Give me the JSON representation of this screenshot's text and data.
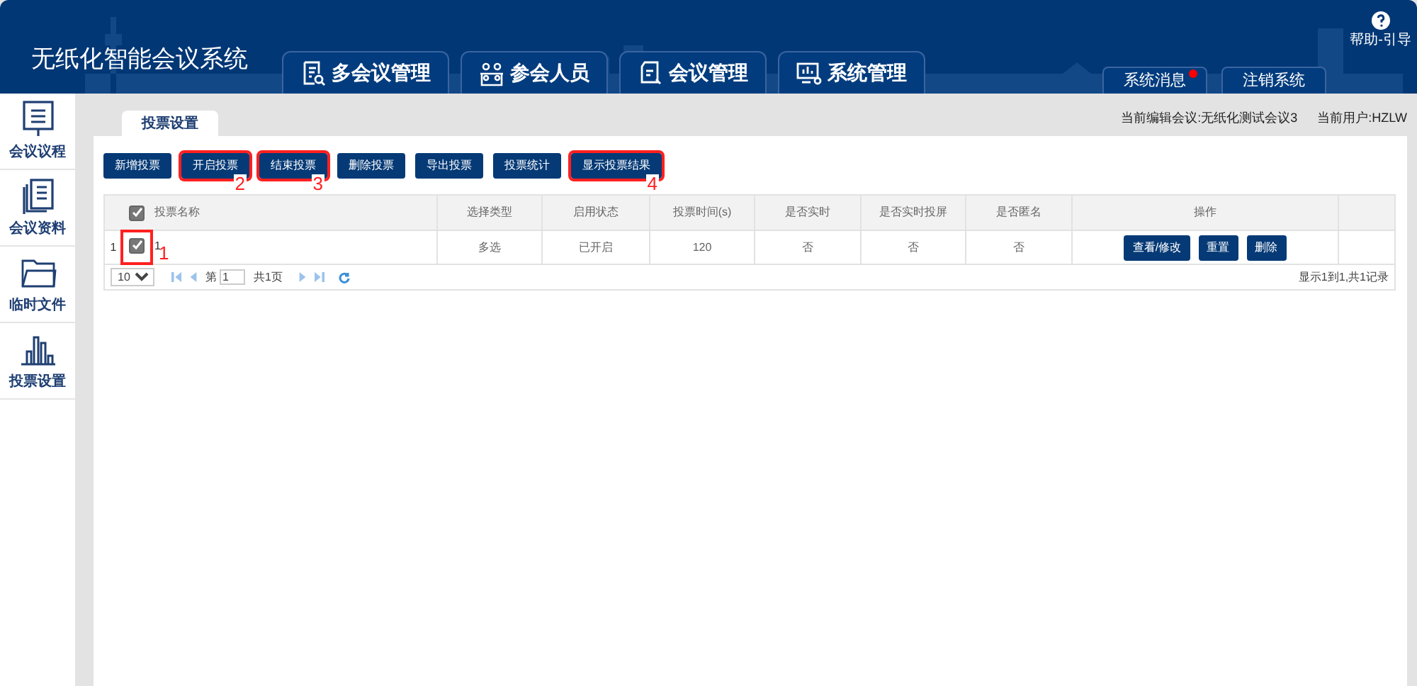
{
  "header": {
    "title": "无纸化智能会议系统",
    "nav": [
      {
        "label": "多会议管理",
        "kind": "search-doc"
      },
      {
        "label": "参会人员",
        "kind": "people"
      },
      {
        "label": "会议管理",
        "kind": "doc"
      },
      {
        "label": "系统管理",
        "kind": "monitor"
      }
    ],
    "help": "帮助-引导",
    "buttons": [
      {
        "label": "系统消息",
        "unread": true
      },
      {
        "label": "注销系统",
        "unread": false
      }
    ]
  },
  "sidebar": {
    "items": [
      {
        "label": "会议议程",
        "kind": "agenda"
      },
      {
        "label": "会议资料",
        "kind": "docs"
      },
      {
        "label": "临时文件",
        "kind": "folder"
      },
      {
        "label": "投票设置",
        "kind": "chart"
      }
    ]
  },
  "tab": {
    "label": "投票设置",
    "selected": true
  },
  "info": [
    "当前编辑会议:无纸化测试会议3",
    "当前用户:HZLW"
  ],
  "toolbar": [
    {
      "label": "新增投票",
      "highlighted": false
    },
    {
      "label": "开启投票",
      "highlighted": true,
      "callout": "2"
    },
    {
      "label": "结束投票",
      "highlighted": true,
      "callout": "3"
    },
    {
      "label": "删除投票",
      "highlighted": false
    },
    {
      "label": "导出投票",
      "highlighted": false
    },
    {
      "label": "投票统计",
      "highlighted": false
    },
    {
      "label": "显示投票结果",
      "highlighted": true,
      "callout": "4"
    }
  ],
  "table": {
    "all_checked": true,
    "columns": [
      "投票名称",
      "选择类型",
      "启用状态",
      "投票时间(s)",
      "是否实时",
      "是否实时投屏",
      "是否匿名",
      "操作"
    ],
    "rows": [
      {
        "number": "1",
        "checked": true,
        "highlighted": true,
        "callout": "1",
        "cells": [
          "1",
          "多选",
          "已开启",
          "120",
          "否",
          "否",
          "否"
        ],
        "actions": [
          "查看/修改",
          "重置",
          "删除"
        ]
      }
    ]
  },
  "pager": {
    "page_size": "10",
    "page_label": "第",
    "page": "1",
    "total_pages": "共1页",
    "summary": "显示1到1,共1记录"
  }
}
